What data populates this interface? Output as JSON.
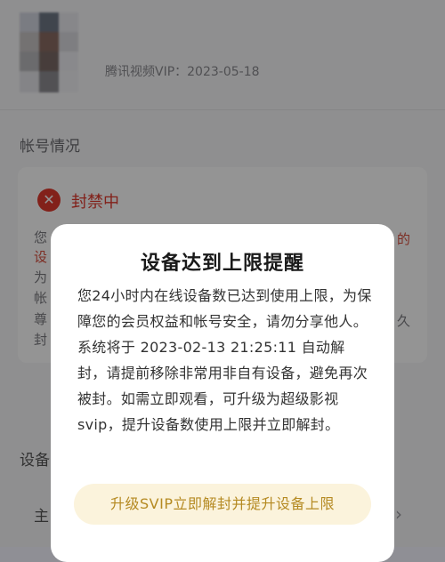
{
  "background": {
    "vip_info": "腾讯视频VIP：2023-05-18",
    "section_title": "帐号情况",
    "ban_status": "封禁中",
    "card_left_fragments": [
      "您",
      "设",
      "为",
      "帐",
      "尊",
      "封"
    ],
    "card_right_fragments": [
      "的",
      "久"
    ],
    "device_section_label": "设备",
    "primary_device_label": "主"
  },
  "modal": {
    "title": "设备达到上限提醒",
    "body": "您24小时内在线设备数已达到使用上限，为保障您的会员权益和帐号安全，请勿分享他人。系统将于 2023-02-13 21:25:11 自动解封，请提前移除非常用非自有设备，避免再次被封。如需立即观看，可升级为超级影视svip，提升设备数使用上限并立即解封。",
    "button_label": "升级SVIP立即解封并提升设备上限"
  },
  "icons": {
    "ban": "close-circle-icon",
    "chevron": "chevron-right-icon"
  },
  "colors": {
    "danger": "#e0392e",
    "button_bg": "#fbf3dc",
    "button_text": "#b58a22"
  }
}
